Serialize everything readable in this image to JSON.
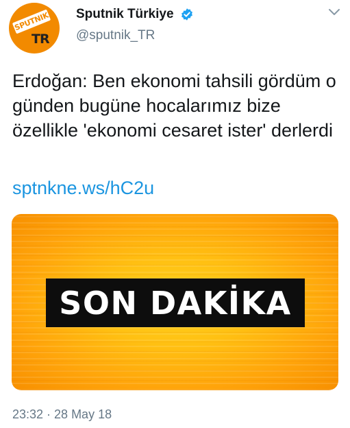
{
  "author": {
    "name": "Sputnik Türkiye",
    "handle": "@sputnik_TR",
    "verified": true,
    "avatar": {
      "banner_text": "SPUTNIK",
      "region_text": "TR",
      "color": "#f28a00"
    }
  },
  "icons": {
    "verified": "verified-badge-icon",
    "menu": "chevron-down-icon"
  },
  "tweet": {
    "text": "Erdoğan: Ben ekonomi tahsili gördüm o günden bugüne hocalarımız bize özellikle 'ekonomi cesaret ister' derlerdi",
    "link": "sptnkne.ws/hC2u"
  },
  "media": {
    "headline": "SON DAKİKA"
  },
  "timestamp": "23:32 · 28 May 18",
  "colors": {
    "link": "#1b95e0",
    "verified": "#1da1f2",
    "muted": "#657786",
    "accent": "#ffb800"
  }
}
